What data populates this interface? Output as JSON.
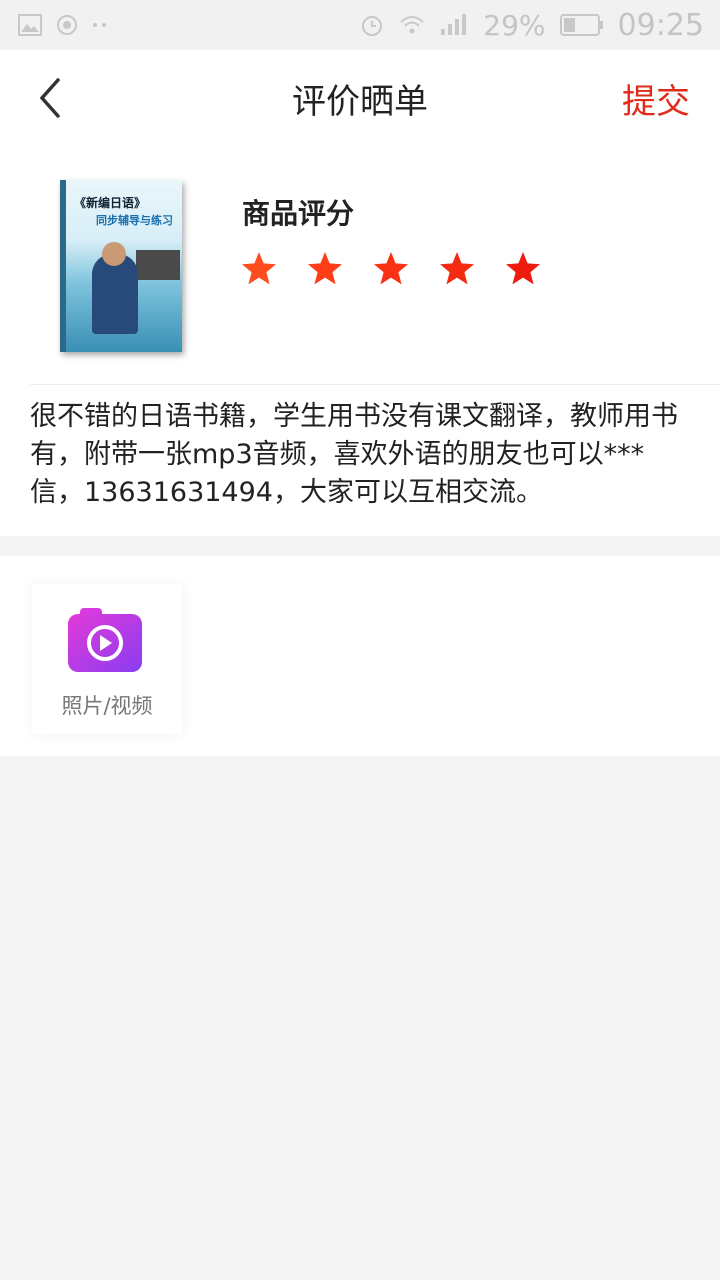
{
  "status_bar": {
    "battery_percent": "29%",
    "time": "09:25"
  },
  "nav": {
    "title": "评价晒单",
    "submit_label": "提交"
  },
  "product": {
    "cover_title": "《新编日语》",
    "cover_subtitle": "同步辅导与练习",
    "rating_label": "商品评分",
    "rating_value": 5,
    "rating_max": 5,
    "star_colors": [
      "#ff4d1f",
      "#ff3d16",
      "#fa3214",
      "#f52a12",
      "#ee1c0e"
    ]
  },
  "review": {
    "text": "很不错的日语书籍，学生用书没有课文翻译，教师用书有，附带一张mp3音频，喜欢外语的朋友也可以***信，13631631494，大家可以互相交流。"
  },
  "media": {
    "upload_label": "照片/视频",
    "icon": "video-camera-icon"
  },
  "colors": {
    "accent": "#e02b1a",
    "background": "#f4f4f4"
  }
}
